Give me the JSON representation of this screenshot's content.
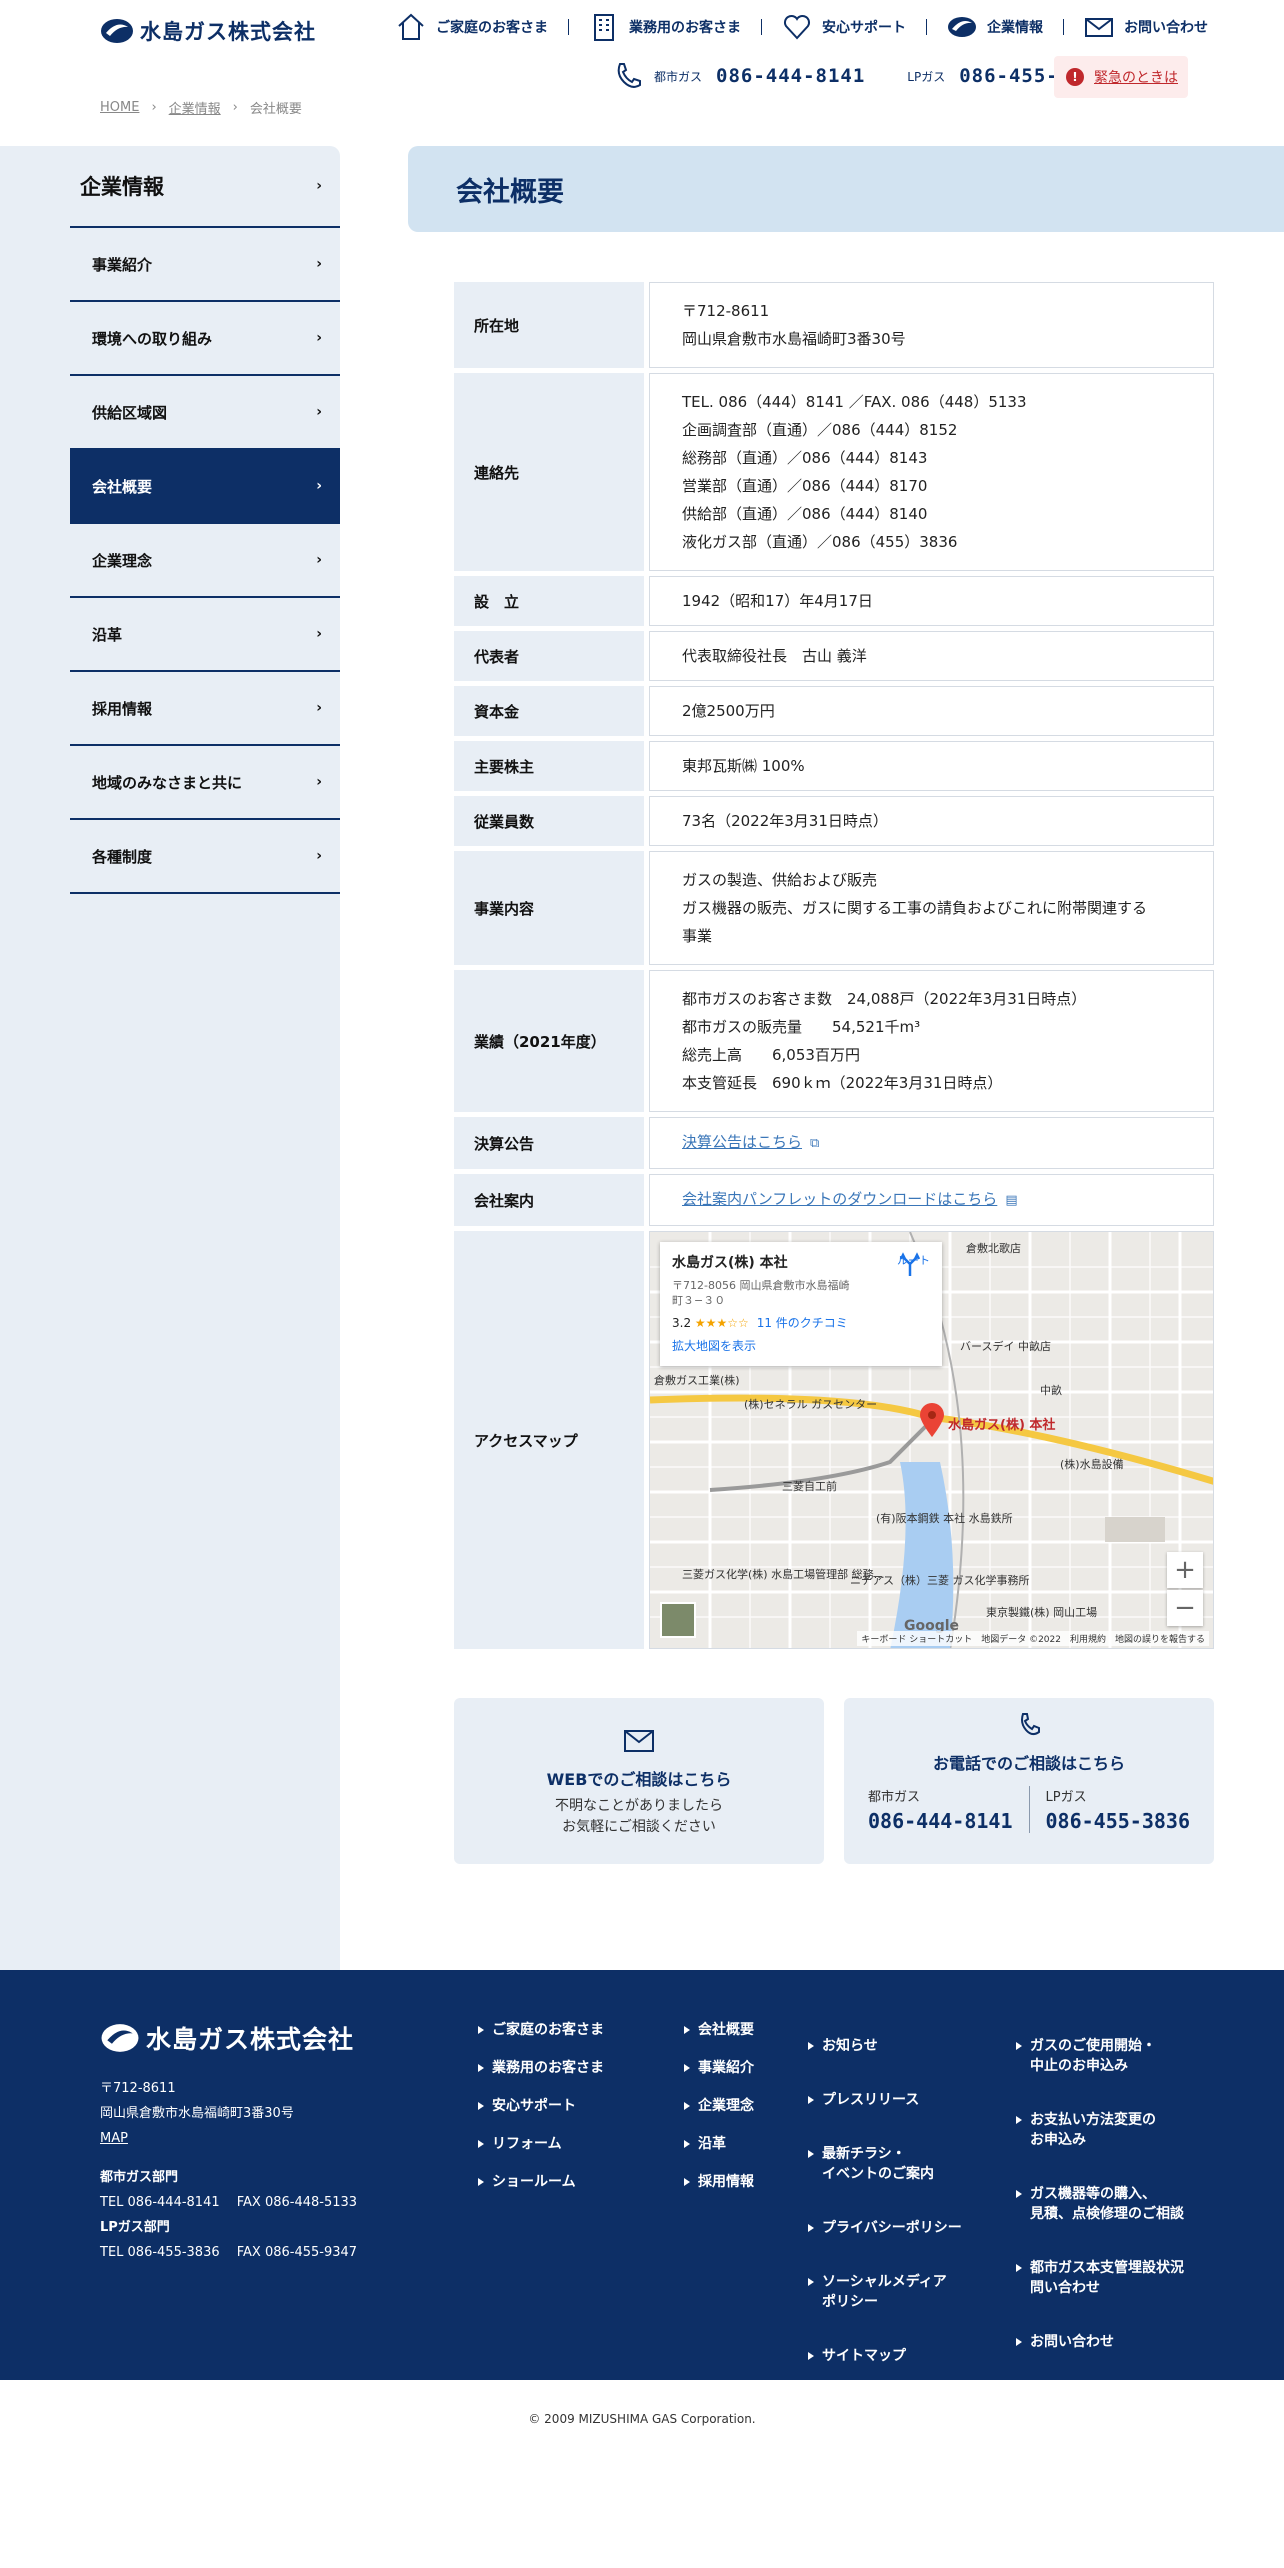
{
  "header": {
    "logo_text": "水島ガス株式会社",
    "nav": [
      {
        "label": "ご家庭のお客さま",
        "icon": "house-icon"
      },
      {
        "label": "業務用のお客さま",
        "icon": "building-icon"
      },
      {
        "label": "安心サポート",
        "icon": "heart-icon"
      },
      {
        "label": "企業情報",
        "icon": "logo-mark-icon"
      },
      {
        "label": "お問い合わせ",
        "icon": "mail-icon"
      }
    ],
    "tels": [
      {
        "label": "都市ガス",
        "number": "086-444-8141"
      },
      {
        "label": "LPガス",
        "number": "086-455-3836"
      }
    ],
    "emergency": "緊急のときは"
  },
  "breadcrumb": [
    "HOME",
    "企業情報",
    "会社概要"
  ],
  "sidebar": {
    "heading": "企業情報",
    "items": [
      "事業紹介",
      "環境への取り組み",
      "供給区域図",
      "会社概要",
      "企業理念",
      "沿革",
      "採用情報",
      "地域のみなさまと共に",
      "各種制度"
    ],
    "active": "会社概要"
  },
  "page_title": "会社概要",
  "company": {
    "address": {
      "label": "所在地",
      "lines": [
        "〒712-8611",
        "岡山県倉敷市水島福崎町3番30号"
      ]
    },
    "contact": {
      "label": "連絡先",
      "lines": [
        "TEL. 086（444）8141 ／FAX. 086（448）5133",
        "企画調査部（直通）／086（444）8152",
        "総務部（直通）／086（444）8143",
        "営業部（直通）／086（444）8170",
        "供給部（直通）／086（444）8140",
        "液化ガス部（直通）／086（455）3836"
      ]
    },
    "founded": {
      "label": "設　立",
      "value": "1942（昭和17）年4月17日"
    },
    "rep": {
      "label": "代表者",
      "value": "代表取締役社長　古山 義洋"
    },
    "capital": {
      "label": "資本金",
      "value": "2億2500万円"
    },
    "shareholder": {
      "label": "主要株主",
      "value": "東邦瓦斯㈱ 100%"
    },
    "employees": {
      "label": "従業員数",
      "value": "73名（2022年3月31日時点）"
    },
    "business": {
      "label": "事業内容",
      "lines": [
        "ガスの製造、供給および販売",
        "ガス機器の販売、ガスに関する工事の請負およびこれに附帯関連する",
        "事業"
      ]
    },
    "results": {
      "label": "業績（2021年度）",
      "lines": [
        "都市ガスのお客さま数　24,088戸（2022年3月31日時点）",
        "都市ガスの販売量　　54,521千m³",
        "総売上高　　6,053百万円",
        "本支管延長　690ｋｍ（2022年3月31日時点）"
      ]
    },
    "kessan": {
      "label": "決算公告",
      "link": "決算公告はこちら"
    },
    "guide": {
      "label": "会社案内",
      "link": "会社案内パンフレットのダウンロードはこちら"
    },
    "access": {
      "label": "アクセスマップ"
    }
  },
  "map": {
    "card_title": "水島ガス(株) 本社",
    "card_address": "〒712-8056 岡山県倉敷市水島福崎町３−３０",
    "rating": "3.2",
    "stars": "★★★☆☆",
    "reviews": "11 件のクチコミ",
    "enlarge": "拡大地図を表示",
    "route": "ルート",
    "pin_label": "水島ガス(株) 本社",
    "places": [
      "倉敷北歌店",
      "バースデイ 中畝店",
      "倉敷ガス工業(株)",
      "(株)セネラル ガスセンター",
      "(株)水島設備",
      "三菱ガス化学(株) 水島工場管理部 総務…",
      "ニチアス（株）三菱 ガス化学事務所",
      "(有)阪本鋼鉄 本社 水島鉄所",
      "東京製鐵(株) 岡山工場",
      "中畝",
      "三菱自工前"
    ],
    "google": "Google",
    "footer": "キーボード ショートカット　地図データ ©2022　利用規約　地図の誤りを報告する",
    "zoom_in": "+",
    "zoom_out": "−"
  },
  "cta": {
    "web_title": "WEBでのご相談はこちら",
    "web_sub1": "不明なことがありましたら",
    "web_sub2": "お気軽にご相談ください",
    "tel_title": "お電話でのご相談はこちら",
    "tel_city_label": "都市ガス",
    "tel_city": "086-444-8141",
    "tel_lp_label": "LPガス",
    "tel_lp": "086-455-3836"
  },
  "footer": {
    "logo_text": "水島ガス株式会社",
    "zip": "〒712-8611",
    "address": "岡山県倉敷市水島福崎町3番30号",
    "map": "MAP",
    "city_dept": "都市ガス部門",
    "city_tel": "TEL 086-444-8141　 FAX 086-448-5133",
    "lp_dept": "LPガス部門",
    "lp_tel": "TEL 086-455-3836　 FAX 086-455-9347",
    "col1": [
      "ご家庭のお客さま",
      "業務用のお客さま",
      "安心サポート",
      "リフォーム",
      "ショールーム"
    ],
    "col2": [
      "会社概要",
      "事業紹介",
      "企業理念",
      "沿革",
      "採用情報"
    ],
    "col3": [
      "お知らせ",
      "プレスリリース",
      "最新チラシ・\nイベントのご案内",
      "プライバシーポリシー",
      "ソーシャルメディア\nポリシー",
      "サイトマップ"
    ],
    "col4": [
      "ガスのご使用開始・\n中止のお申込み",
      "お支払い方法変更の\nお申込み",
      "ガス機器等の購入、\n見積、点検修理のご相談",
      "都市ガス本支管埋設状況\n問い合わせ",
      "お問い合わせ"
    ]
  },
  "copyright": "© 2009 MIZUSHIMA GAS Corporation.",
  "colors": {
    "brand": "#0d2f66",
    "light": "#e8eef5",
    "title_bg": "#d2e3f1",
    "alert": "#c0282c",
    "link": "#3a76b8"
  }
}
